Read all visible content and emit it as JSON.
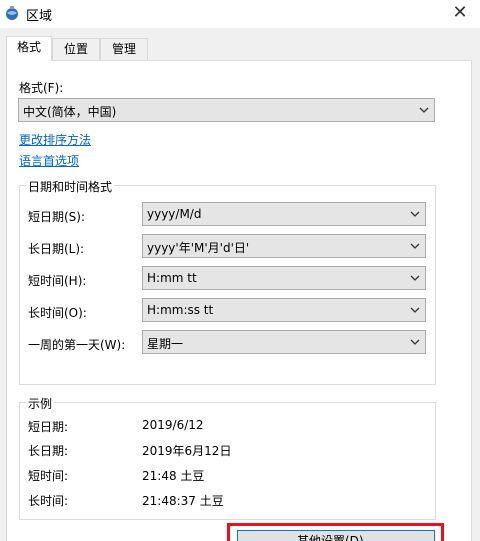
{
  "window": {
    "title": "区域",
    "close_glyph": "✕"
  },
  "tabs": [
    {
      "label": "格式",
      "active": true
    },
    {
      "label": "位置",
      "active": false
    },
    {
      "label": "管理",
      "active": false
    }
  ],
  "format": {
    "label": "格式(F):",
    "value": "中文(简体，中国)",
    "links": {
      "sort": "更改排序方法",
      "lang": "语言首选项"
    }
  },
  "datetime": {
    "title": "日期和时间格式",
    "fields": [
      {
        "label": "短日期(S):",
        "value": "yyyy/M/d"
      },
      {
        "label": "长日期(L):",
        "value": "yyyy'年'M'月'd'日'"
      },
      {
        "label": "短时间(H):",
        "value": "H:mm tt"
      },
      {
        "label": "长时间(O):",
        "value": "H:mm:ss tt"
      },
      {
        "label": "一周的第一天(W):",
        "value": "星期一"
      }
    ]
  },
  "examples": {
    "title": "示例",
    "rows": [
      {
        "label": "短日期:",
        "value": "2019/6/12"
      },
      {
        "label": "长日期:",
        "value": "2019年6月12日"
      },
      {
        "label": "短时间:",
        "value": "21:48 土豆"
      },
      {
        "label": "长时间:",
        "value": "21:48:37 土豆"
      }
    ]
  },
  "buttons": {
    "other": "其他设置(D)..."
  },
  "colors": {
    "link": "#0066cc",
    "highlight": "#e81123",
    "focus": "#0078d7"
  }
}
